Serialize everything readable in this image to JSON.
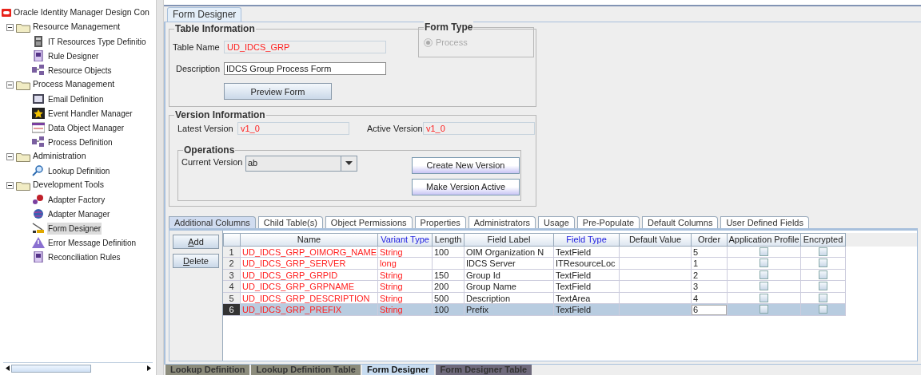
{
  "tree": {
    "label": "Oracle Identity Manager Design Con",
    "children": [
      {
        "label": "Resource Management",
        "expanded": true,
        "children": [
          {
            "label": "IT Resources Type Definitio",
            "kind": "calculator",
            "selected": false
          },
          {
            "label": "Rule Designer",
            "kind": "document",
            "selected": false
          },
          {
            "label": "Resource Objects",
            "kind": "flow",
            "selected": false
          }
        ]
      },
      {
        "label": "Process Management",
        "expanded": true,
        "children": [
          {
            "label": "Email Definition",
            "kind": "card",
            "selected": false
          },
          {
            "label": "Event Handler Manager",
            "kind": "star",
            "selected": false
          },
          {
            "label": "Data Object Manager",
            "kind": "calendar",
            "selected": false
          },
          {
            "label": "Process Definition",
            "kind": "flow",
            "selected": false
          }
        ]
      },
      {
        "label": "Administration",
        "expanded": true,
        "children": [
          {
            "label": "Lookup Definition",
            "kind": "magnifier",
            "selected": false
          }
        ]
      },
      {
        "label": "Development Tools",
        "expanded": true,
        "children": [
          {
            "label": "Adapter Factory",
            "kind": "gears",
            "selected": false
          },
          {
            "label": "Adapter Manager",
            "kind": "globe",
            "selected": false
          },
          {
            "label": "Form Designer",
            "kind": "crane",
            "selected": true
          },
          {
            "label": "Error Message Definition",
            "kind": "warning",
            "selected": false
          },
          {
            "label": "Reconciliation Rules",
            "kind": "document",
            "selected": false
          }
        ]
      }
    ]
  },
  "main_tab": {
    "label": "Form Designer"
  },
  "table_information": {
    "title": "Table Information",
    "table_name_label": "Table Name",
    "table_name": "UD_IDCS_GRP",
    "description_label": "Description",
    "description": "IDCS Group Process Form",
    "preview_button": "Preview Form"
  },
  "form_type": {
    "title": "Form Type",
    "option": "Process",
    "selected": true,
    "disabled": true
  },
  "version_information": {
    "title": "Version Information",
    "latest_label": "Latest Version",
    "latest": "v1_0",
    "active_label": "Active Version",
    "active": "v1_0"
  },
  "operations": {
    "title": "Operations",
    "current_label": "Current Version",
    "current": "ab",
    "buttons": [
      "Create New Version",
      "Make Version Active"
    ]
  },
  "sub_tabs": [
    {
      "label": "Additional Columns",
      "selected": true
    },
    {
      "label": "Child Table(s)",
      "selected": false
    },
    {
      "label": "Object Permissions",
      "selected": false
    },
    {
      "label": "Properties",
      "selected": false
    },
    {
      "label": "Administrators",
      "selected": false
    },
    {
      "label": "Usage",
      "selected": false
    },
    {
      "label": "Pre-Populate",
      "selected": false
    },
    {
      "label": "Default Columns",
      "selected": false
    },
    {
      "label": "User Defined Fields",
      "selected": false
    }
  ],
  "grid_buttons": [
    "Add",
    "Delete"
  ],
  "table": {
    "columns": [
      {
        "label": "Name",
        "emphasized": false
      },
      {
        "label": "Variant Type",
        "emphasized": true
      },
      {
        "label": "Length",
        "emphasized": false
      },
      {
        "label": "Field Label",
        "emphasized": false
      },
      {
        "label": "Field Type",
        "emphasized": true
      },
      {
        "label": "Default Value",
        "emphasized": false
      },
      {
        "label": "Order",
        "emphasized": false
      },
      {
        "label": "Application Profile",
        "emphasized": false
      },
      {
        "label": "Encrypted",
        "emphasized": false
      }
    ],
    "rows": [
      {
        "number": "1",
        "name": "UD_IDCS_GRP_OIMORG_NAME",
        "variant_type": "String",
        "length": "100",
        "field_label": "OIM Organization N",
        "field_type": "TextField",
        "order": "5",
        "application_profile": false,
        "encrypted": false,
        "selected": false
      },
      {
        "number": "2",
        "name": "UD_IDCS_GRP_SERVER",
        "variant_type": "long",
        "field_label": "IDCS Server",
        "field_type": "ITResourceLoc",
        "order": "1",
        "application_profile": false,
        "encrypted": false,
        "selected": false
      },
      {
        "number": "3",
        "name": "UD_IDCS_GRP_GRPID",
        "variant_type": "String",
        "length": "150",
        "field_label": "Group Id",
        "field_type": "TextField",
        "order": "2",
        "application_profile": false,
        "encrypted": false,
        "selected": false
      },
      {
        "number": "4",
        "name": "UD_IDCS_GRP_GRPNAME",
        "variant_type": "String",
        "length": "200",
        "field_label": "Group Name",
        "field_type": "TextField",
        "order": "3",
        "application_profile": false,
        "encrypted": false,
        "selected": false
      },
      {
        "number": "5",
        "name": "UD_IDCS_GRP_DESCRIPTION",
        "variant_type": "String",
        "length": "500",
        "field_label": "Description",
        "field_type": "TextArea",
        "order": "4",
        "application_profile": false,
        "encrypted": false,
        "selected": false
      },
      {
        "number": "6",
        "name": "UD_IDCS_GRP_PREFIX",
        "variant_type": "String",
        "length": "100",
        "field_label": "Prefix",
        "field_type": "TextField",
        "order": "6",
        "application_profile": false,
        "encrypted": false,
        "selected": true
      }
    ]
  },
  "document_tabs": [
    {
      "label": "Lookup Definition",
      "selected": false,
      "color": "#8c8c7c"
    },
    {
      "label": "Lookup Definition Table",
      "selected": false,
      "color": "#8c8c7c"
    },
    {
      "label": "Form Designer",
      "selected": true,
      "color": "#c8dcf0"
    },
    {
      "label": "Form Designer Table",
      "selected": false,
      "color": "#6f6a7c"
    }
  ]
}
